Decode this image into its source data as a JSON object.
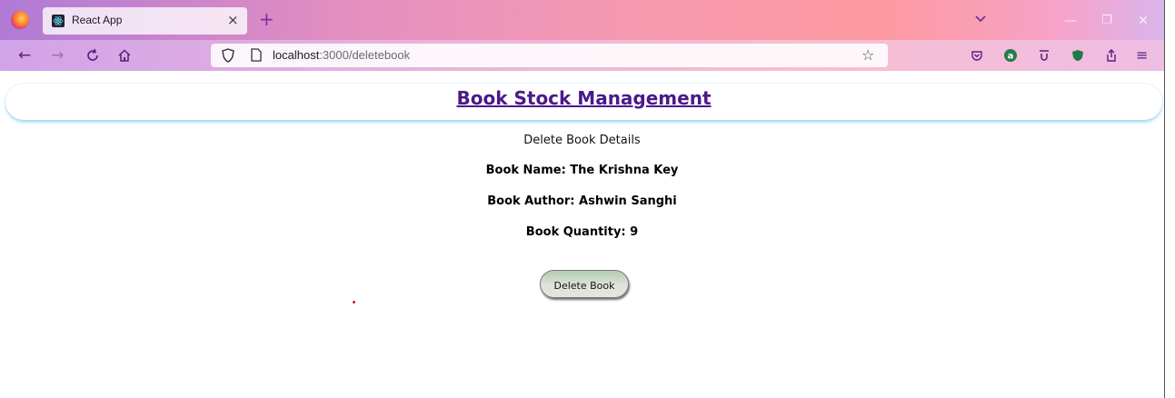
{
  "browser": {
    "tab": {
      "title": "React App",
      "close_glyph": "×"
    },
    "new_tab_glyph": "+",
    "url": {
      "host": "localhost",
      "path": ":3000/deletebook"
    },
    "nav": {
      "back": "←",
      "forward": "→",
      "reload": "C",
      "home": "⌂"
    },
    "window": {
      "min": "—",
      "max": "❐",
      "close": "✕"
    },
    "tab_list_glyph": "⌄",
    "bookmark_glyph": "☆",
    "menu_glyph": "≡",
    "extensions": [
      "pocket-icon",
      "account-icon",
      "download-icon",
      "shield-extension-icon",
      "share-icon"
    ]
  },
  "page": {
    "header_title": "Book Stock Management",
    "section_title": "Delete Book Details",
    "book": {
      "name_text": "Book Name: The Krishna Key",
      "author_text": "Book Author: Ashwin Sanghi",
      "quantity_text": "Book Quantity: 9"
    },
    "delete_button_label": "Delete Book"
  },
  "colors": {
    "title": "#4a1a8a",
    "header_shadow": "#8fd0ee",
    "chrome_gradient_start": "#b07ad6",
    "chrome_gradient_end": "#fd9aa0"
  }
}
